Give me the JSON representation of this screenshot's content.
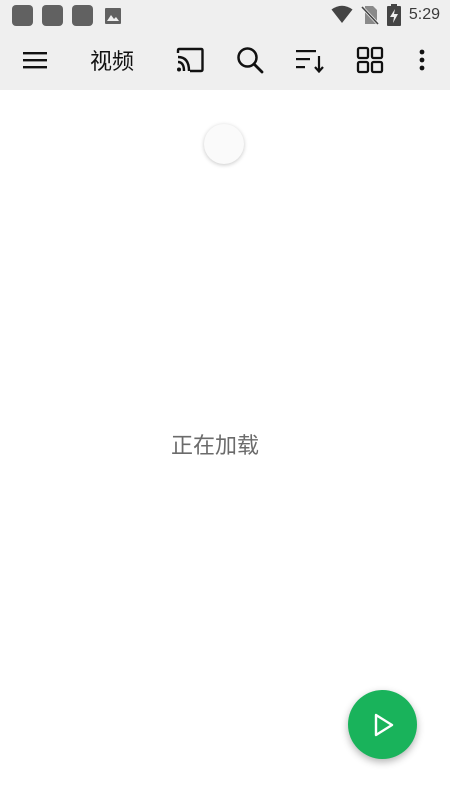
{
  "status_bar": {
    "time": "5:29",
    "icons": [
      "app-notification-icon",
      "app-notification-icon",
      "app-notification-icon",
      "image-icon",
      "wifi-icon",
      "no-sim-icon",
      "battery-charging-icon"
    ]
  },
  "toolbar": {
    "title": "视频",
    "icons": [
      "menu-icon",
      "cast-icon",
      "search-icon",
      "sort-icon",
      "grid-view-icon",
      "more-vert-icon"
    ]
  },
  "content": {
    "loading_text": "正在加载"
  },
  "fab": {
    "icon": "play-icon",
    "color": "#19b35b"
  },
  "colors": {
    "toolbar_bg": "#efefef",
    "accent": "#19b35b"
  }
}
